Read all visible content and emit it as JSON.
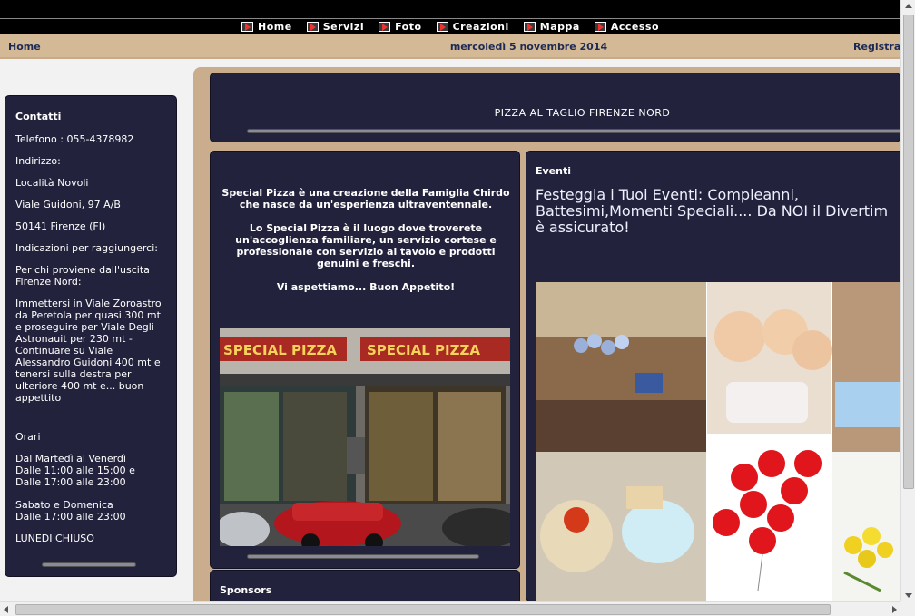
{
  "nav": {
    "items": [
      {
        "label": "Home",
        "icon": "play-icon"
      },
      {
        "label": "Servizi",
        "icon": "play-icon"
      },
      {
        "label": "Foto",
        "icon": "play-icon"
      },
      {
        "label": "Creazioni",
        "icon": "play-icon"
      },
      {
        "label": "Mappa",
        "icon": "play-icon"
      },
      {
        "label": "Accesso",
        "icon": "play-icon"
      }
    ]
  },
  "infobar": {
    "home": "Home",
    "date": "mercoledì 5 novembre 2014",
    "register": "Registrazio"
  },
  "sidebar": {
    "title": "Contatti",
    "lines": [
      "Telefono : 055-4378982",
      "Indirizzo:",
      "Località Novoli",
      "Viale Guidoni, 97 A/B",
      "50141 Firenze (FI)",
      "Indicazioni per raggiungerci:",
      "Per chi proviene dall'uscita Firenze Nord:",
      "Immettersi in Viale Zoroastro da Peretola per quasi 300 mt e proseguire per Viale Degli Astronauit per 230 mt - Continuare su Viale Alessandro Guidoni 400 mt e tenersi sulla destra per ulteriore 400 mt e... buon appettito"
    ],
    "hours_title": "Orari",
    "hours": [
      "Dal Martedì al Venerdì",
      "Dalle 11:00 alle 15:00 e",
      "Dalle 17:00 alle 23:00",
      "Sabato e Domenica",
      "Dalle 17:00 alle 23:00",
      "LUNEDI CHIUSO"
    ]
  },
  "header": {
    "title": "PIZZA AL TAGLIO FIRENZE NORD"
  },
  "intro": {
    "p1": "Special Pizza è una creazione della Famiglia Chirdo che nasce da un'esperienza ultraventennale.",
    "p2": "Lo Special Pizza è il luogo dove troverete un'accoglienza familiare, un servizio cortese e professionale con servizio al tavolo e prodotti genuini e freschi.",
    "p3": "Vi aspettiamo... Buon Appetito!",
    "sign": "SPECIAL PIZZA"
  },
  "sponsors": {
    "title": "Sponsors"
  },
  "events": {
    "title": "Eventi",
    "line1": "Festeggia i Tuoi Eventi: Compleanni,",
    "line2": "Battesimi,Momenti Speciali.... Da NOI il Divertim",
    "line3": "è assicurato!"
  },
  "colors": {
    "panel": "#22223d",
    "tan": "#c9ad8c",
    "infobar": "#d4b996",
    "link": "#1c2a55"
  }
}
